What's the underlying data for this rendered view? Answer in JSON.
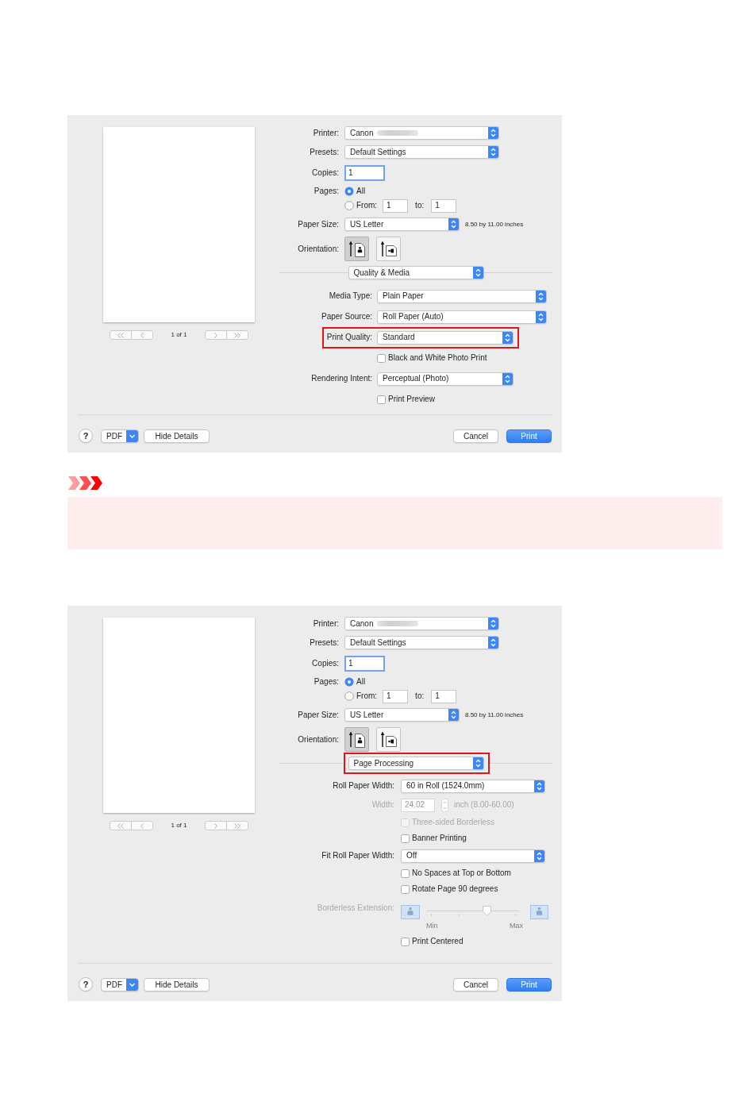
{
  "blocks": [
    {
      "kind": "dialog",
      "preview": {
        "page_counter": "1 of 1"
      },
      "printer": {
        "label": "Printer:",
        "value": "Canon",
        "blurred": true
      },
      "presets": {
        "label": "Presets:",
        "value": "Default Settings"
      },
      "copies": {
        "label": "Copies:",
        "value": "1",
        "focused": true
      },
      "pages": {
        "label": "Pages:",
        "options": [
          {
            "label": "All",
            "selected": true
          },
          {
            "label": "From:",
            "selected": false
          }
        ],
        "from": "1",
        "to_label": "to:",
        "to": "1"
      },
      "paper_size": {
        "label": "Paper Size:",
        "value": "US Letter",
        "note": "8.50 by 11.00 inches"
      },
      "orientation": {
        "label": "Orientation:",
        "options": [
          {
            "kind": "portrait",
            "selected": true
          },
          {
            "kind": "landscape",
            "selected": false
          }
        ]
      },
      "panel_menu": {
        "value": "Quality & Media",
        "highlighted": false
      },
      "panel_rows": [
        {
          "kind": "popup",
          "label": "Media Type:",
          "value": "Plain Paper",
          "highlighted": false,
          "disabled": false
        },
        {
          "kind": "popup",
          "label": "Paper Source:",
          "value": "Roll Paper (Auto)",
          "highlighted": false,
          "disabled": false
        },
        {
          "kind": "popup",
          "label": "Print Quality:",
          "value": "Standard",
          "highlighted": true,
          "disabled": false
        },
        {
          "kind": "checkbox",
          "label": "Black and White Photo Print",
          "checked": false,
          "highlighted": false,
          "disabled": false
        },
        {
          "kind": "popup",
          "label": "Rendering Intent:",
          "value": "Perceptual (Photo)",
          "highlighted": false,
          "disabled": false
        },
        {
          "kind": "checkbox",
          "label": "Print Preview",
          "checked": false,
          "highlighted": false,
          "disabled": false
        }
      ],
      "footer": {
        "help": "?",
        "pdf": "PDF",
        "hide_details": "Hide Details",
        "cancel": "Cancel",
        "print": "Print"
      }
    },
    {
      "kind": "notice"
    },
    {
      "kind": "dialog",
      "preview": {
        "page_counter": "1 of 1"
      },
      "printer": {
        "label": "Printer:",
        "value": "Canon",
        "blurred": true
      },
      "presets": {
        "label": "Presets:",
        "value": "Default Settings"
      },
      "copies": {
        "label": "Copies:",
        "value": "1",
        "focused": true
      },
      "pages": {
        "label": "Pages:",
        "options": [
          {
            "label": "All",
            "selected": true
          },
          {
            "label": "From:",
            "selected": false
          }
        ],
        "from": "1",
        "to_label": "to:",
        "to": "1"
      },
      "paper_size": {
        "label": "Paper Size:",
        "value": "US Letter",
        "note": "8.50 by 11.00 inches"
      },
      "orientation": {
        "label": "Orientation:",
        "options": [
          {
            "kind": "portrait",
            "selected": true
          },
          {
            "kind": "landscape",
            "selected": false
          }
        ]
      },
      "panel_menu": {
        "value": "Page Processing",
        "highlighted": true
      },
      "panel_rows": [
        {
          "kind": "popup",
          "label": "Roll Paper Width:",
          "value": "60 in Roll (1524.0mm)",
          "highlighted": false,
          "disabled": false
        },
        {
          "kind": "number",
          "label": "Width:",
          "value": "24.02",
          "unit": "inch (8.00-60.00)",
          "highlighted": false,
          "disabled": true
        },
        {
          "kind": "checkbox",
          "label": "Three-sided Borderless",
          "checked": false,
          "highlighted": false,
          "disabled": true
        },
        {
          "kind": "checkbox",
          "label": "Banner Printing",
          "checked": false,
          "highlighted": false,
          "disabled": false
        },
        {
          "kind": "popup",
          "label": "Fit Roll Paper Width:",
          "value": "Off",
          "highlighted": false,
          "disabled": false
        },
        {
          "kind": "checkbox",
          "label": "No Spaces at Top or Bottom",
          "checked": false,
          "highlighted": false,
          "disabled": false
        },
        {
          "kind": "checkbox",
          "label": "Rotate Page 90 degrees",
          "checked": false,
          "highlighted": false,
          "disabled": false
        },
        {
          "kind": "slider",
          "label": "Borderless Extension:",
          "level": 0.65,
          "min_label": "Min",
          "max_label": "Max",
          "highlighted": false,
          "disabled": true
        },
        {
          "kind": "checkbox",
          "label": "Print Centered",
          "checked": false,
          "highlighted": false,
          "disabled": false
        }
      ],
      "footer": {
        "help": "?",
        "pdf": "PDF",
        "hide_details": "Hide Details",
        "cancel": "Cancel",
        "print": "Print"
      }
    }
  ]
}
